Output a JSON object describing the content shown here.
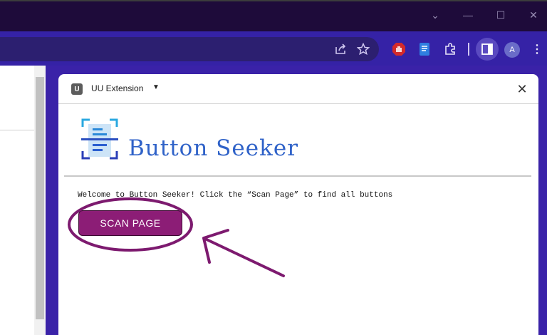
{
  "browser": {
    "window_controls": [
      "chevron-down-icon",
      "minimize-icon",
      "maximize-icon",
      "close-icon"
    ],
    "toolbar_icons": [
      "share-icon",
      "star-icon",
      "adblock-icon",
      "document-extension-icon",
      "puzzle-icon",
      "sidepanel-icon"
    ],
    "avatar_letter": "A"
  },
  "panel": {
    "badge": "U",
    "extension_name": "UU Extension",
    "close_label": "✕"
  },
  "app": {
    "title": "Button Seeker",
    "welcome_text": "Welcome to Button Seeker! Click the “Scan Page” to find all buttons",
    "scan_button_label": "SCAN PAGE"
  },
  "colors": {
    "accent": "#2f62c8",
    "button": "#8c1d76",
    "annotation": "#7d1a6f"
  }
}
